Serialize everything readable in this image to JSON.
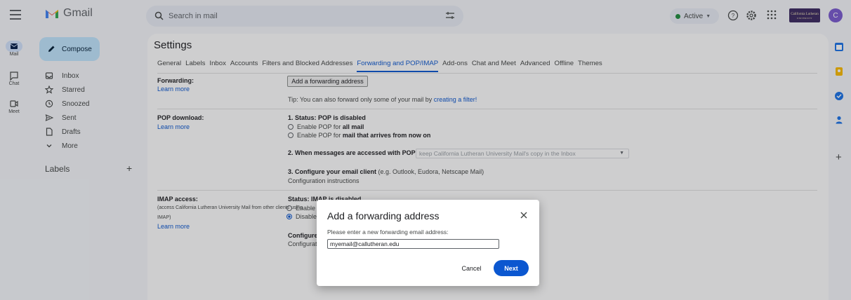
{
  "app": {
    "name": "Gmail"
  },
  "search": {
    "placeholder": "Search in mail"
  },
  "status": {
    "label": "Active"
  },
  "org": {
    "line1": "California Lutheran",
    "line2": "UNIVERSITY"
  },
  "user": {
    "initial": "C"
  },
  "rail": [
    {
      "label": "Mail",
      "icon": "mail-icon"
    },
    {
      "label": "Chat",
      "icon": "chat-icon"
    },
    {
      "label": "Meet",
      "icon": "video-icon"
    }
  ],
  "compose": {
    "label": "Compose"
  },
  "nav": [
    {
      "label": "Inbox",
      "icon": "inbox-icon"
    },
    {
      "label": "Starred",
      "icon": "star-icon"
    },
    {
      "label": "Snoozed",
      "icon": "clock-icon"
    },
    {
      "label": "Sent",
      "icon": "send-icon"
    },
    {
      "label": "Drafts",
      "icon": "draft-icon"
    },
    {
      "label": "More",
      "icon": "chevron-down-icon"
    }
  ],
  "labels": {
    "title": "Labels",
    "add": "+"
  },
  "settings": {
    "title": "Settings",
    "tabs": [
      "General",
      "Labels",
      "Inbox",
      "Accounts",
      "Filters and Blocked Addresses",
      "Forwarding and POP/IMAP",
      "Add-ons",
      "Chat and Meet",
      "Advanced",
      "Offline",
      "Themes"
    ],
    "active_tab": "Forwarding and POP/IMAP",
    "forwarding": {
      "title": "Forwarding:",
      "learn_more": "Learn more",
      "button": "Add a forwarding address",
      "tip_prefix": "Tip: You can also forward only some of your mail by ",
      "tip_link": "creating a filter!"
    },
    "pop": {
      "title": "POP download:",
      "learn_more": "Learn more",
      "status": "1. Status: POP is disabled",
      "opt1_prefix": "Enable POP for ",
      "opt1_bold": "all mail",
      "opt2_prefix": "Enable POP for ",
      "opt2_bold": "mail that arrives from now on",
      "step2": "2. When messages are accessed with POP",
      "step2_select": "keep California Lutheran University Mail's copy in the Inbox",
      "step3_bold": "3. Configure your email client",
      "step3_rest": " (e.g. Outlook, Eudora, Netscape Mail)",
      "config_link": "Configuration instructions"
    },
    "imap": {
      "title": "IMAP access:",
      "desc": "(access California Lutheran University Mail from other clients using IMAP)",
      "learn_more": "Learn more",
      "status": "Status: IMAP is disabled",
      "opt1": "Enable",
      "opt2": "Disable",
      "configure": "Configure",
      "config_link": "Configurat"
    }
  },
  "dialog": {
    "title": "Add a forwarding address",
    "label": "Please enter a new forwarding email address:",
    "input_value": "myemail@callutheran.edu",
    "cancel": "Cancel",
    "next": "Next"
  },
  "colors": {
    "accent": "#0b57d0",
    "compose": "#c2e7ff",
    "active_dot": "#1e8e3e"
  }
}
